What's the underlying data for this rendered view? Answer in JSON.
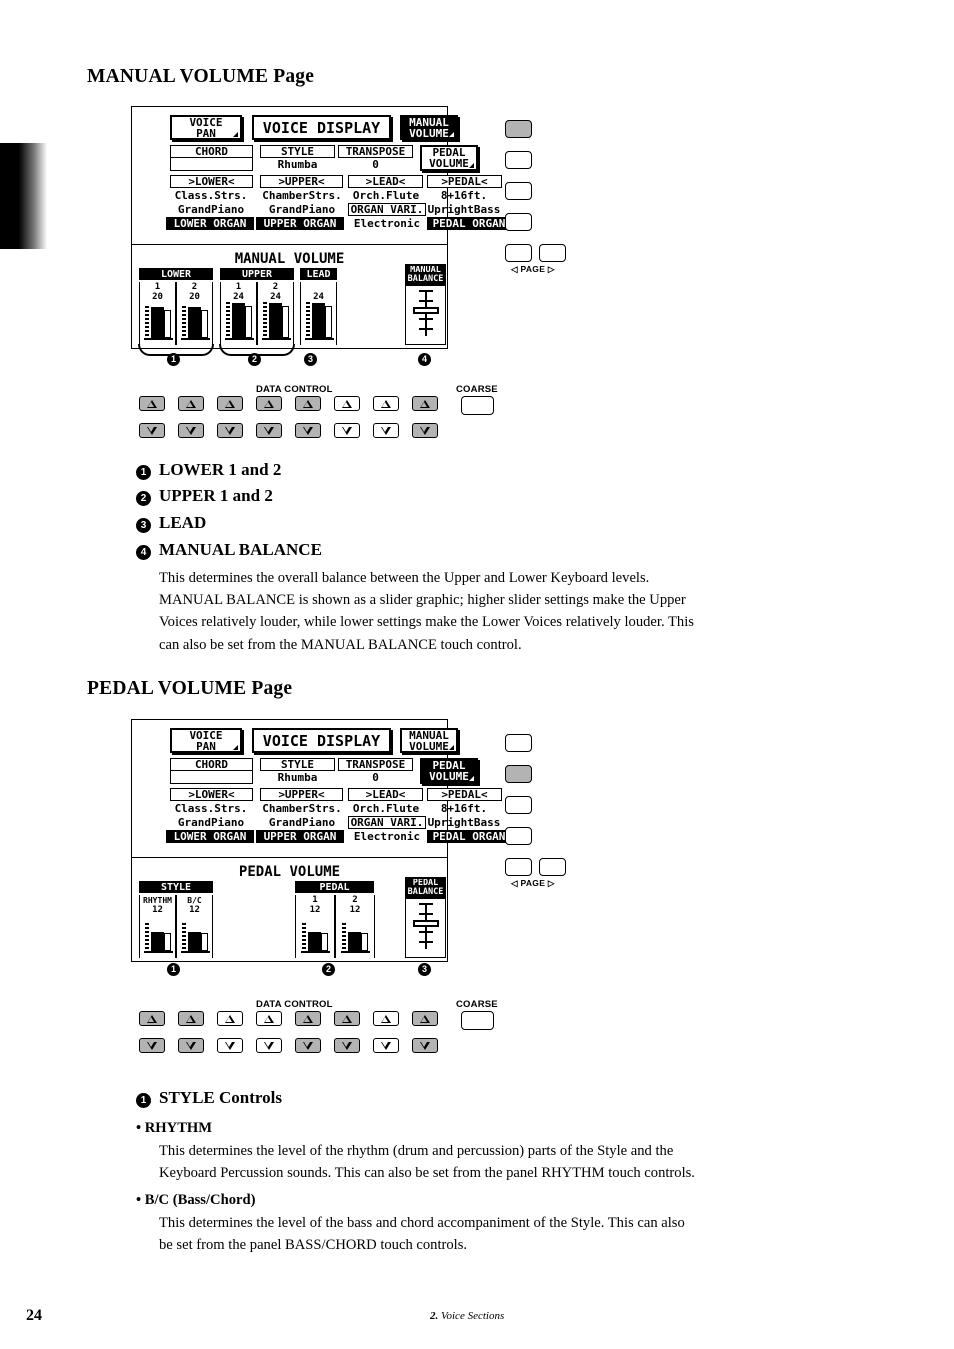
{
  "document": {
    "page_number": "24",
    "footer_section_num": "2.",
    "footer_section_title": "Voice Sections"
  },
  "sections": [
    {
      "heading": "MANUAL VOLUME Page",
      "lcd": {
        "row1": {
          "voice_pan": "VOICE\nPAN",
          "voice_display": "VOICE DISPLAY",
          "manual_volume": "MANUAL\nVOLUME",
          "manual_volume_selected": true,
          "pedal_volume": "PEDAL\nVOLUME",
          "pedal_volume_selected": false
        },
        "row2": {
          "chord": "CHORD",
          "chord_value": "",
          "style": "STYLE",
          "style_value": "Rhumba",
          "transpose": "TRANSPOSE",
          "transpose_value": "0"
        },
        "voices": {
          "headers": [
            ">LOWER<",
            ">UPPER<",
            ">LEAD<",
            ">PEDAL<"
          ],
          "line1": [
            "Class.Strs.",
            "ChamberStrs.",
            "Orch.Flute",
            "8+16ft."
          ],
          "line2": [
            "GrandPiano",
            "GrandPiano",
            "ORGAN VARI.",
            "UprightBass"
          ],
          "line3": [
            "LOWER ORGAN",
            "UPPER ORGAN",
            "Electronic",
            "PEDAL ORGAN"
          ],
          "line2_boxed": [
            false,
            false,
            true,
            false
          ],
          "line3_inverted": [
            true,
            true,
            false,
            true
          ]
        },
        "volume": {
          "title": "MANUAL VOLUME",
          "groups": [
            {
              "header": "LOWER",
              "channels": [
                {
                  "label": "1",
                  "value": "20"
                },
                {
                  "label": "2",
                  "value": "20"
                }
              ]
            },
            {
              "header": "UPPER",
              "channels": [
                {
                  "label": "1",
                  "value": "24"
                },
                {
                  "label": "2",
                  "value": "24"
                }
              ]
            },
            {
              "header": "LEAD",
              "channels": [
                {
                  "label": "",
                  "value": "24"
                }
              ]
            }
          ],
          "balance": {
            "label": "MANUAL\nBALANCE",
            "line1": "MANUAL",
            "line2": "BALANCE"
          }
        }
      },
      "panel_buttons": {
        "states": [
          true,
          false,
          false,
          false
        ],
        "page_label_left": "◁",
        "page_label_text": "PAGE",
        "page_label_right": "▷"
      },
      "data_control": {
        "label": "DATA CONTROL",
        "coarse_label": "COARSE",
        "states": [
          true,
          true,
          true,
          true,
          true,
          false,
          false,
          true
        ]
      },
      "callouts": [
        "1",
        "2",
        "3",
        "4"
      ],
      "list": [
        {
          "num": "1",
          "title": "LOWER 1 and 2",
          "body": []
        },
        {
          "num": "2",
          "title": "UPPER 1 and 2",
          "body": []
        },
        {
          "num": "3",
          "title": "LEAD",
          "body": []
        },
        {
          "num": "4",
          "title": "MANUAL BALANCE",
          "body": [
            "This determines the overall balance between the Upper and Lower Keyboard levels.",
            "MANUAL BALANCE is shown as a slider graphic; higher slider settings make the Upper",
            "Voices relatively louder, while lower settings make the Lower Voices relatively louder.  This",
            "can also be set from the MANUAL BALANCE touch control."
          ]
        }
      ]
    },
    {
      "heading": "PEDAL VOLUME Page",
      "lcd": {
        "row1": {
          "voice_pan": "VOICE\nPAN",
          "voice_display": "VOICE DISPLAY",
          "manual_volume": "MANUAL\nVOLUME",
          "manual_volume_selected": false,
          "pedal_volume": "PEDAL\nVOLUME",
          "pedal_volume_selected": true
        },
        "row2": {
          "chord": "CHORD",
          "chord_value": "",
          "style": "STYLE",
          "style_value": "Rhumba",
          "transpose": "TRANSPOSE",
          "transpose_value": "0"
        },
        "voices": {
          "headers": [
            ">LOWER<",
            ">UPPER<",
            ">LEAD<",
            ">PEDAL<"
          ],
          "line1": [
            "Class.Strs.",
            "ChamberStrs.",
            "Orch.Flute",
            "8+16ft."
          ],
          "line2": [
            "GrandPiano",
            "GrandPiano",
            "ORGAN VARI.",
            "UprightBass"
          ],
          "line3": [
            "LOWER ORGAN",
            "UPPER ORGAN",
            "Electronic",
            "PEDAL ORGAN"
          ],
          "line2_boxed": [
            false,
            false,
            true,
            false
          ],
          "line3_inverted": [
            true,
            true,
            false,
            true
          ]
        },
        "volume": {
          "title": "PEDAL VOLUME",
          "groups": [
            {
              "header": "STYLE",
              "channels": [
                {
                  "label": "RHYTHM",
                  "value": "12"
                },
                {
                  "label": "B/C",
                  "value": "12"
                }
              ]
            },
            {
              "header": "PEDAL",
              "channels": [
                {
                  "label": "1",
                  "value": "12"
                },
                {
                  "label": "2",
                  "value": "12"
                }
              ]
            }
          ],
          "balance": {
            "label": "PEDAL\nBALANCE",
            "line1": "PEDAL",
            "line2": "BALANCE"
          }
        }
      },
      "panel_buttons": {
        "states": [
          false,
          true,
          false,
          false
        ],
        "page_label_left": "◁",
        "page_label_text": "PAGE",
        "page_label_right": "▷"
      },
      "data_control": {
        "label": "DATA CONTROL",
        "coarse_label": "COARSE",
        "states": [
          true,
          true,
          false,
          false,
          true,
          true,
          false,
          true
        ]
      },
      "callouts": [
        "1",
        "2",
        "3"
      ],
      "list": [
        {
          "num": "1",
          "title": "STYLE Controls",
          "body": []
        }
      ],
      "bullets": [
        {
          "title": "RHYTHM",
          "body": [
            "This determines the level of the rhythm (drum and percussion) parts of the Style and the",
            "Keyboard Percussion sounds. This can also be set from the panel RHYTHM touch controls."
          ]
        },
        {
          "title": "B/C (Bass/Chord)",
          "body": [
            "This determines the level of the bass and chord accompaniment of the Style.  This can also",
            "be set from the panel BASS/CHORD touch controls."
          ]
        }
      ]
    }
  ]
}
